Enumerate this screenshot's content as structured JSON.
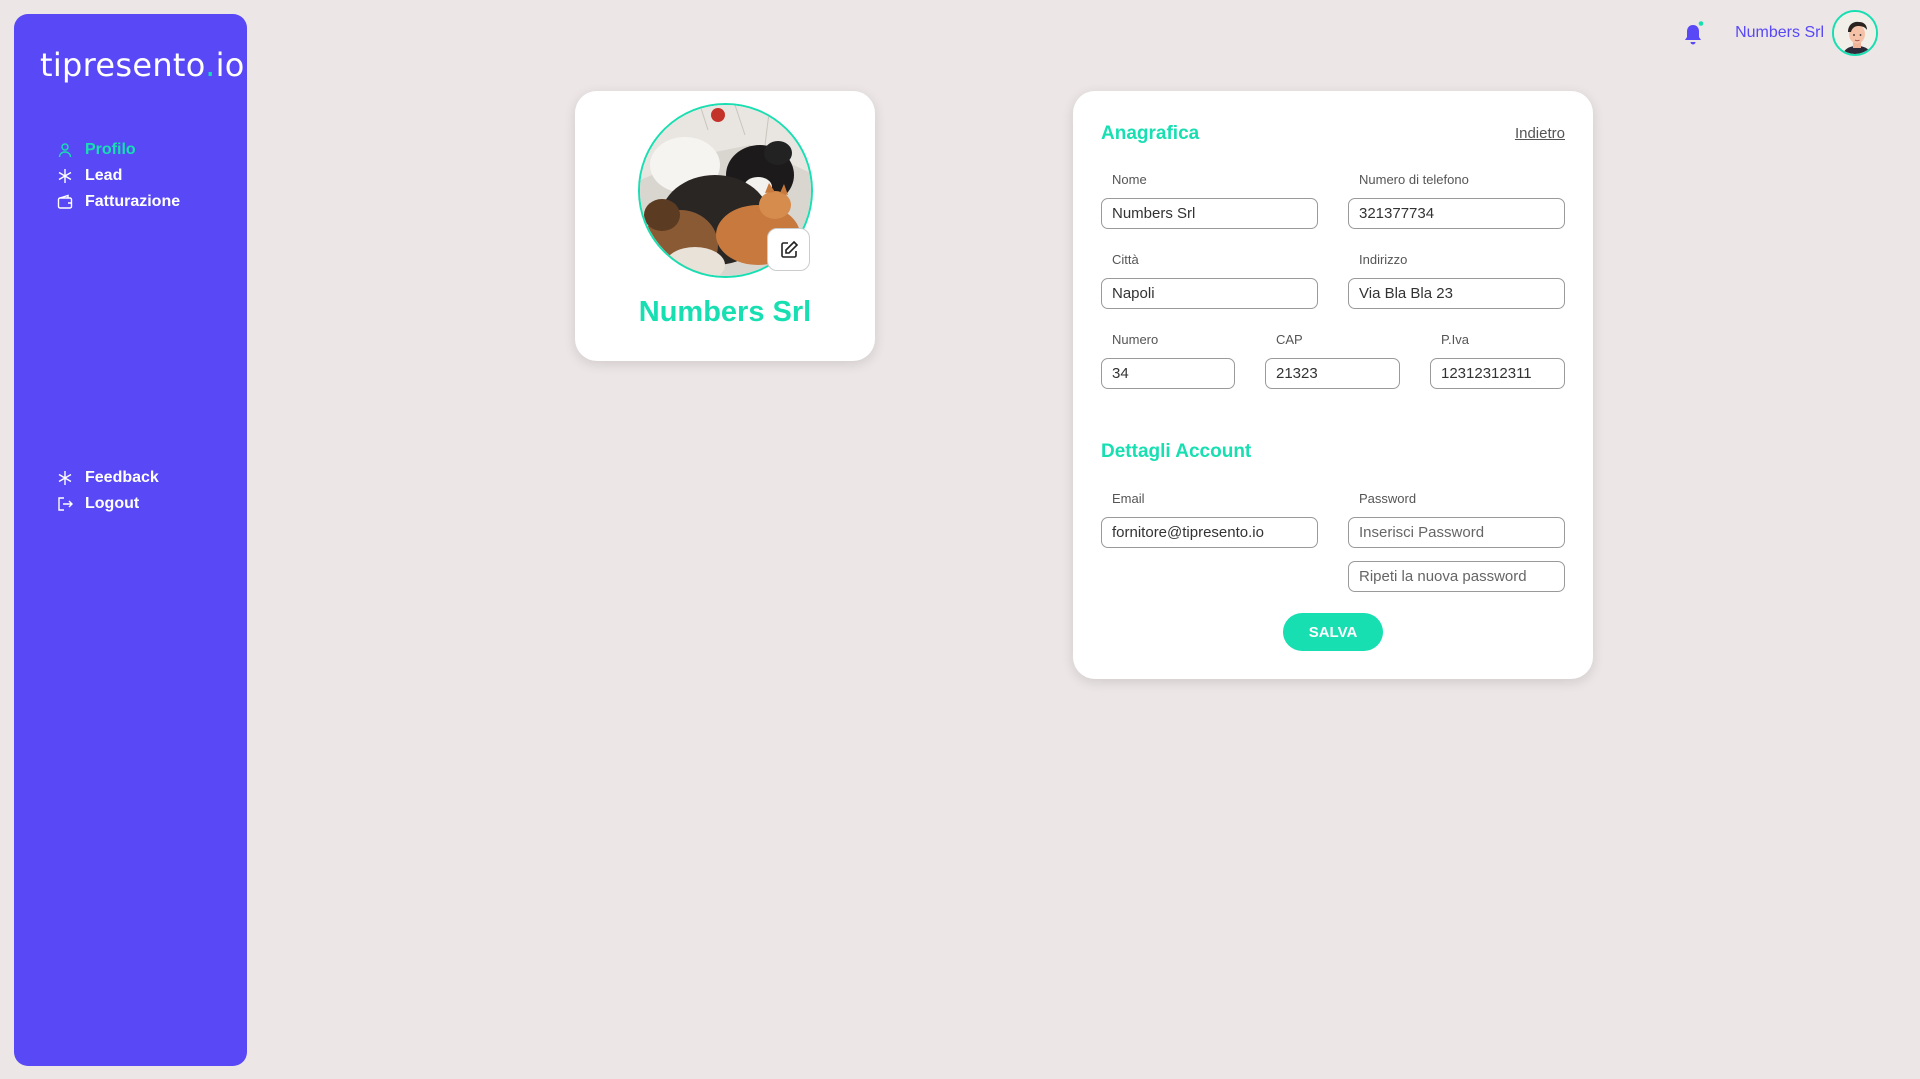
{
  "brand": {
    "logo_main": "tipresento",
    "logo_dot": ".",
    "logo_tld": "io"
  },
  "colors": {
    "sidebar": "#5848f6",
    "accent": "#18dfb2",
    "background": "#ece6e6"
  },
  "sidebar": {
    "top_items": [
      {
        "label": "Profilo",
        "icon": "user-icon",
        "active": true
      },
      {
        "label": "Lead",
        "icon": "snowflake-icon",
        "active": false
      },
      {
        "label": "Fatturazione",
        "icon": "wallet-icon",
        "active": false
      }
    ],
    "bottom_items": [
      {
        "label": "Feedback",
        "icon": "snowflake-icon"
      },
      {
        "label": "Logout",
        "icon": "logout-icon"
      }
    ]
  },
  "topbar": {
    "user_name": "Numbers Srl",
    "bell_icon": "bell-icon",
    "notification_dot": true
  },
  "profile": {
    "name": "Numbers Srl"
  },
  "form": {
    "anagrafica_title": "Anagrafica",
    "back_label": "Indietro",
    "fields": {
      "nome": {
        "label": "Nome",
        "value": "Numbers Srl"
      },
      "telefono": {
        "label": "Numero di telefono",
        "value": "321377734"
      },
      "citta": {
        "label": "Città",
        "value": "Napoli"
      },
      "indirizzo": {
        "label": "Indirizzo",
        "value": "Via Bla Bla 23"
      },
      "numero": {
        "label": "Numero",
        "value": "34"
      },
      "cap": {
        "label": "CAP",
        "value": "21323"
      },
      "piva": {
        "label": "P.Iva",
        "value": "12312312311"
      }
    },
    "account_title": "Dettagli Account",
    "email": {
      "label": "Email",
      "value": "fornitore@tipresento.io"
    },
    "password": {
      "label": "Password",
      "placeholder": "Inserisci Password",
      "repeat_placeholder": "Ripeti la nuova password"
    },
    "save_label": "SALVA"
  }
}
